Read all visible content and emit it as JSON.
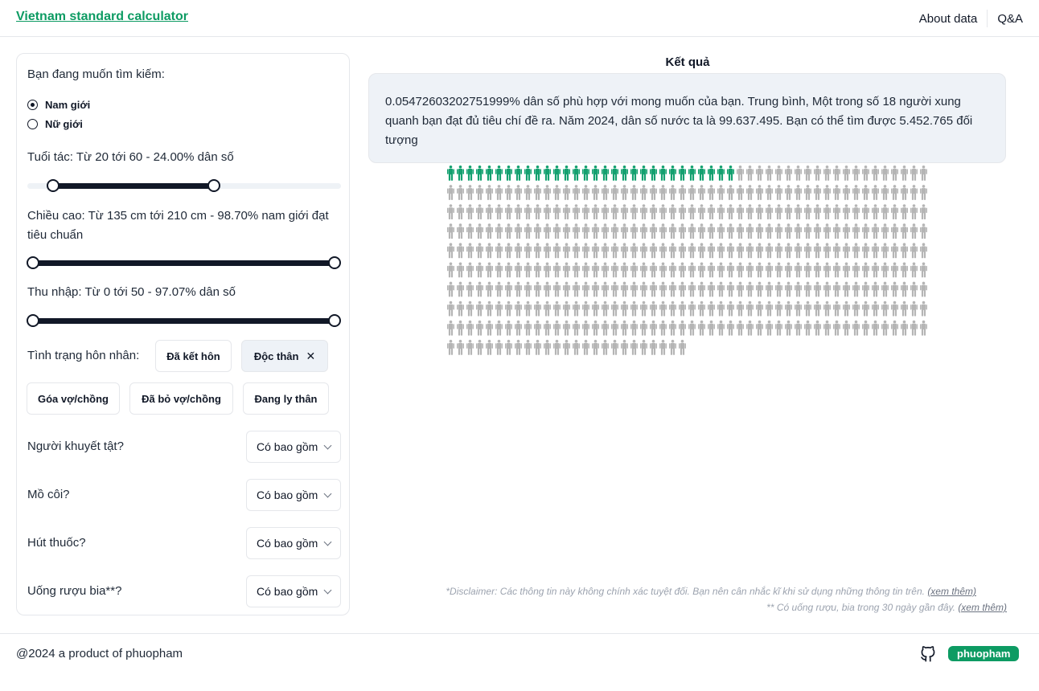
{
  "header": {
    "brand": "Vietnam standard calculator",
    "nav": [
      "About data",
      "Q&A"
    ]
  },
  "form": {
    "search_label": "Bạn đang muốn tìm kiếm:",
    "gender_options": [
      {
        "label": "Nam giới",
        "selected": true
      },
      {
        "label": "Nữ giới",
        "selected": false
      }
    ],
    "age_label": "Tuổi tác: Từ 20 tới 60 - 24.00% dân số",
    "age_range": [
      20,
      60
    ],
    "height_label": "Chiều cao: Từ 135 cm tới 210 cm - 98.70% nam giới đạt tiêu chuẩn",
    "height_range": [
      135,
      210
    ],
    "income_label": "Thu nhập: Từ 0 tới 50 - 97.07% dân số",
    "income_range": [
      0,
      50
    ],
    "marital_label": "Tình trạng hôn nhân:",
    "marital_options": [
      {
        "label": "Đã kết hôn",
        "active": false
      },
      {
        "label": "Độc thân",
        "active": true
      },
      {
        "label": "Góa vợ/chồng",
        "active": false
      },
      {
        "label": "Đã bỏ vợ/chồng",
        "active": false
      },
      {
        "label": "Đang ly thân",
        "active": false
      }
    ],
    "filters": [
      {
        "label": "Người khuyết tật?",
        "value": "Có bao gồm"
      },
      {
        "label": "Mồ côi?",
        "value": "Có bao gồm"
      },
      {
        "label": "Hút thuốc?",
        "value": "Có bao gồm"
      },
      {
        "label": "Uống rượu bia**?",
        "value": "Có bao gồm"
      }
    ]
  },
  "result": {
    "title": "Kết quả",
    "text": "0.05472603202751999% dân số phù hợp với mong muốn của bạn. Trung bình, Một trong số 18 người xung quanh bạn đạt đủ tiêu chí đề ra. Năm 2024, dân số nước ta là 99.637.495. Bạn có thể tìm được 5.452.765 đối tượng",
    "icons_total": 475,
    "icons_highlighted": 30,
    "highlight_color": "#13a06f",
    "base_color": "#b5b5b5"
  },
  "disclaimer": {
    "line1": "*Disclaimer: Các thông tin này không chính xác tuyệt đối. Bạn nên cân nhắc kĩ khi sử dụng những thông tin trên.",
    "line2": "** Có uống rượu, bia trong 30 ngày gần đây.",
    "link": "(xem thêm)"
  },
  "footer": {
    "copyright": "@2024 a product of phuopham",
    "badge": "phuopham",
    "icon": "github-icon"
  }
}
